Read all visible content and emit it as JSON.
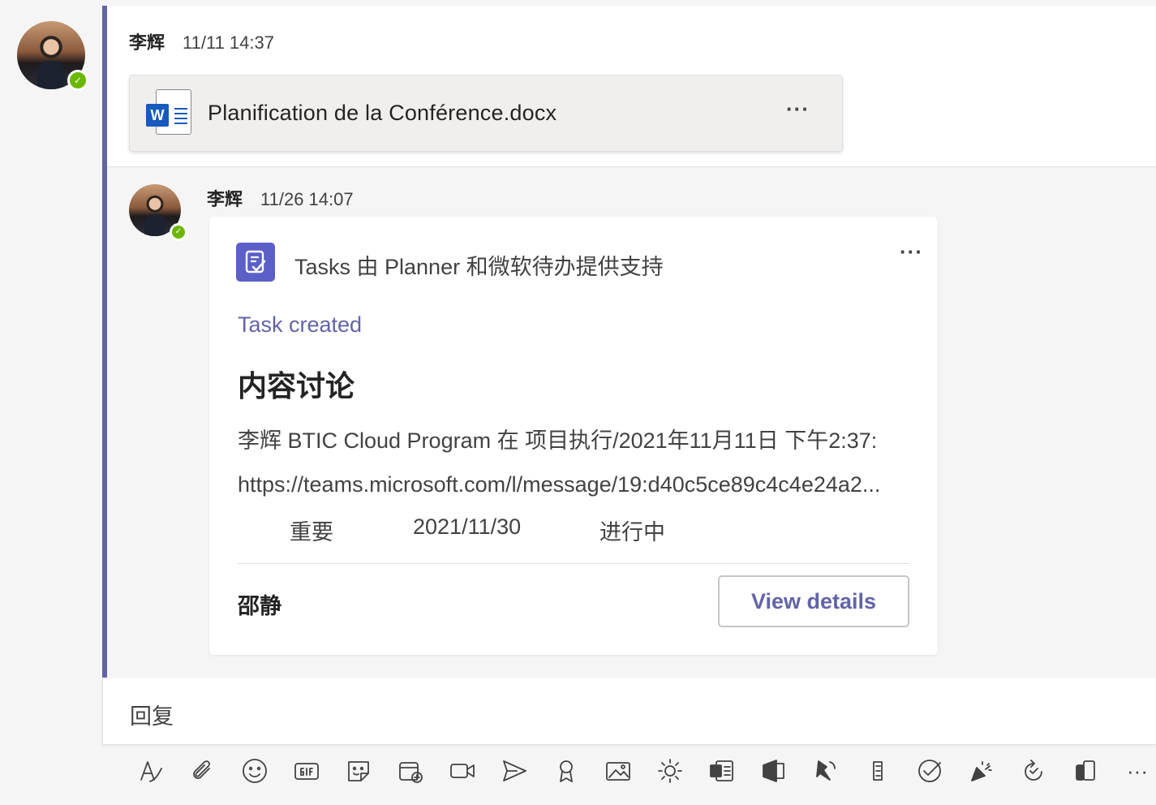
{
  "messages": [
    {
      "author": "李辉",
      "timestamp": "11/11 14:37",
      "attachment": {
        "file_name": "Planification de la Conférence.docx",
        "file_type": "word"
      }
    },
    {
      "author": "李辉",
      "timestamp": "11/26 14:07",
      "card": {
        "app_title": "Tasks 由 Planner 和微软待办提供支持",
        "status": "Task created",
        "task_title": "内容讨论",
        "description": "李辉 BTIC Cloud Program 在 项目执行/2021年11月11日 下午2:37:",
        "link": "https://teams.microsoft.com/l/message/19:d40c5ce89c4c4e24a2...",
        "priority": "重要",
        "due_date": "2021/11/30",
        "progress": "进行中",
        "assignee": "邵静",
        "button_label": "View details"
      }
    }
  ],
  "more_label": "···",
  "presence_mark": "✓",
  "reply": {
    "placeholder": "回复"
  },
  "toolbar": {
    "icons": [
      "format-icon",
      "attach-icon",
      "emoji-icon",
      "gif-icon",
      "sticker-icon",
      "schedule-meeting-icon",
      "video-icon",
      "send-icon",
      "praise-icon",
      "image-icon",
      "brightness-icon",
      "forms-icon",
      "stream-icon",
      "broadcast-icon",
      "evernote-icon",
      "approvals-icon",
      "celebrate-icon",
      "loop-icon",
      "ok-icon",
      "more-icon"
    ]
  },
  "colors": {
    "accent": "#6264a7",
    "presence": "#6bb700",
    "word": "#185abd",
    "planner": "#5b5fc7"
  }
}
